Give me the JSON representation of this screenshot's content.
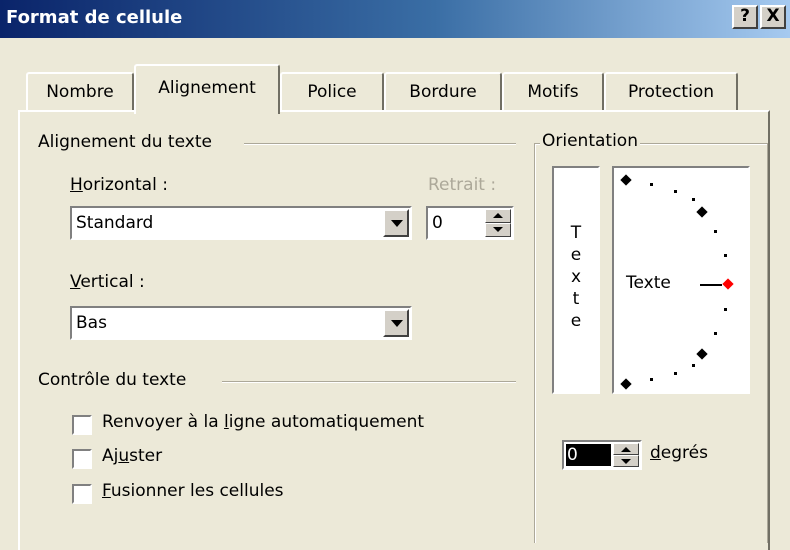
{
  "window": {
    "title": "Format de cellule",
    "help_button": "?",
    "close_button": "X"
  },
  "tabs": [
    {
      "label": "Nombre",
      "active": false
    },
    {
      "label": "Alignement",
      "active": true
    },
    {
      "label": "Police",
      "active": false
    },
    {
      "label": "Bordure",
      "active": false
    },
    {
      "label": "Motifs",
      "active": false
    },
    {
      "label": "Protection",
      "active": false
    }
  ],
  "alignment": {
    "group_title": "Alignement du texte",
    "horizontal": {
      "label_prefix": "",
      "label_accel": "H",
      "label_rest": "orizontal :",
      "value": "Standard"
    },
    "indent": {
      "label": "Retrait :",
      "value": "0"
    },
    "vertical": {
      "label_accel": "V",
      "label_rest": "ertical :",
      "value": "Bas"
    }
  },
  "text_control": {
    "group_title": "Contrôle du texte",
    "wrap": {
      "pre": "Renvoyer à la ",
      "accel": "l",
      "post": "igne automatiquement",
      "checked": false
    },
    "shrink": {
      "pre": "Aj",
      "accel": "u",
      "post": "ster",
      "checked": false
    },
    "merge": {
      "pre": "",
      "accel": "F",
      "post": "usionner les cellules",
      "checked": false
    }
  },
  "orientation": {
    "group_title": "Orientation",
    "vertical_text": [
      "T",
      "e",
      "x",
      "t",
      "e"
    ],
    "dial_label": "Texte",
    "degrees_value": "0",
    "degrees_accel": "d",
    "degrees_rest": "egrés",
    "accent_color": "#ff0000"
  },
  "colors": {
    "title_start": "#0a246a",
    "title_end": "#a6caf0",
    "face": "#ece9d8"
  }
}
